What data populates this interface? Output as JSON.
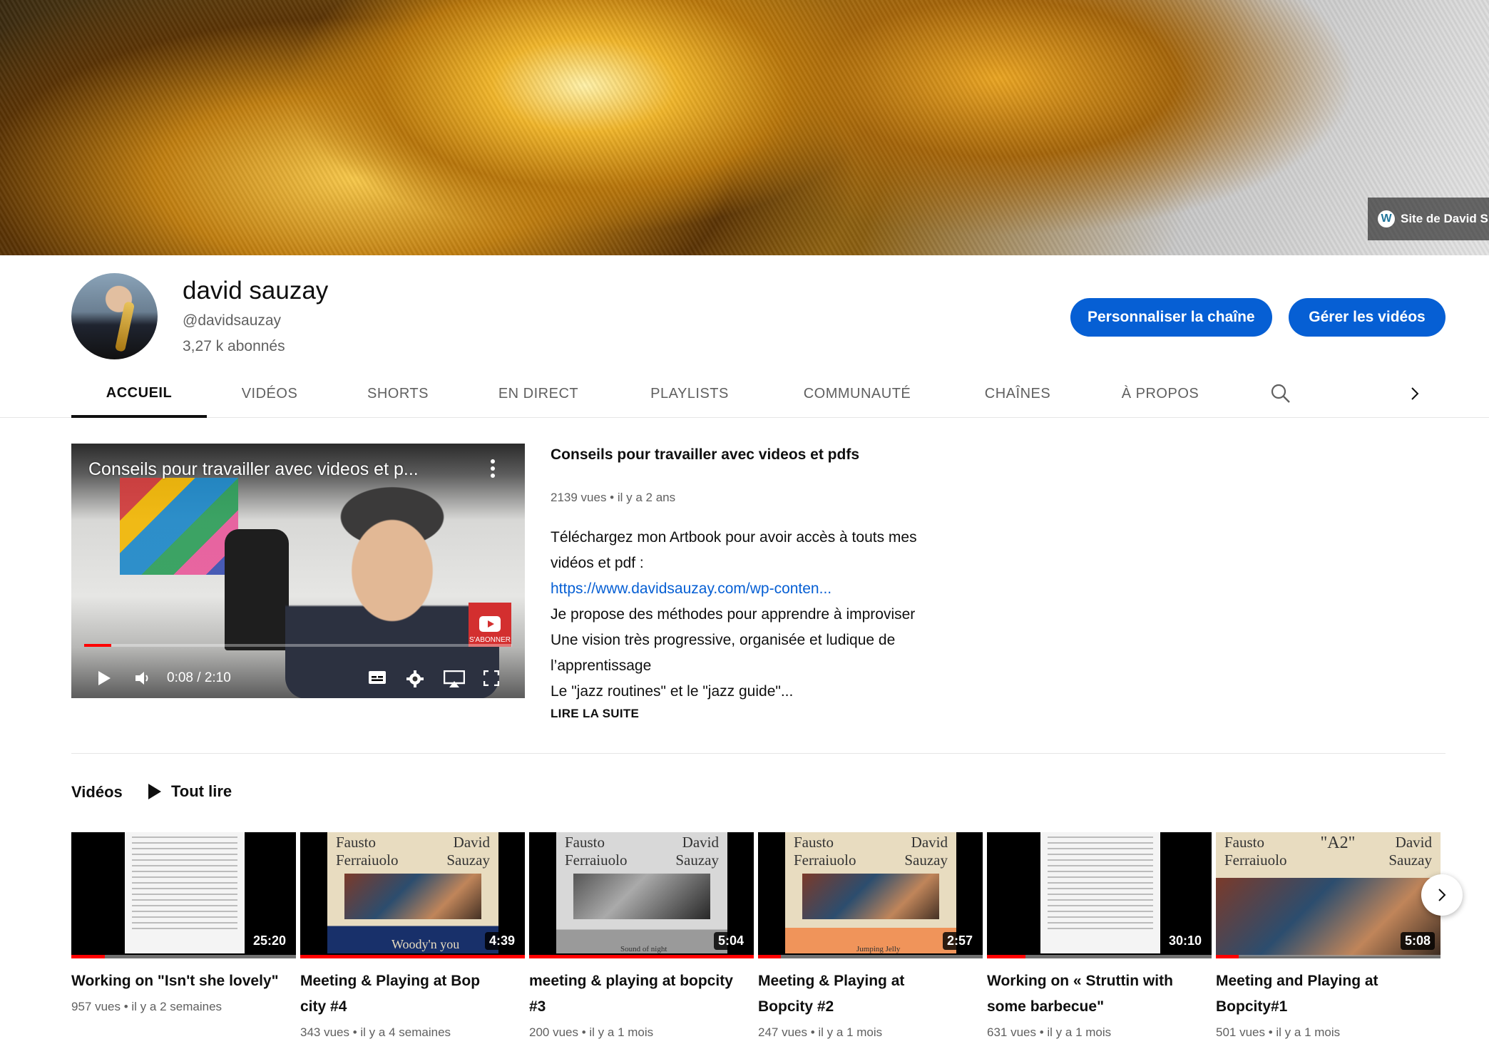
{
  "banner": {
    "link_label": "Site de David S"
  },
  "channel": {
    "name": "david sauzay",
    "handle": "@davidsauzay",
    "subscribers": "3,27 k abonnés",
    "customize_label": "Personnaliser la chaîne",
    "manage_label": "Gérer les vidéos"
  },
  "tabs": [
    "ACCUEIL",
    "VIDÉOS",
    "SHORTS",
    "EN DIRECT",
    "PLAYLISTS",
    "COMMUNAUTÉ",
    "CHAÎNES",
    "À PROPOS"
  ],
  "featured": {
    "overlay_title": "Conseils pour travailler avec videos et p...",
    "subscribe_badge": "S'ABONNER",
    "time": "0:08 / 2:10",
    "progress_fraction": 0.064,
    "title": "Conseils pour travailler avec videos et pdfs",
    "views": "2139 vues",
    "age": "il y a 2 ans",
    "desc_lines": [
      "Téléchargez mon Artbook pour avoir accès à touts mes",
      "vidéos et pdf :",
      "https://www.davidsauzay.com/wp-conten...",
      "Je propose des méthodes pour apprendre à improviser",
      "Une vision très progressive, organisée et ludique de",
      "l’apprentissage",
      "Le \"jazz routines\" et le \"jazz guide\"..."
    ],
    "read_more": "LIRE LA SUITE"
  },
  "shelf": {
    "title": "Vidéos",
    "play_all": "Tout lire",
    "videos": [
      {
        "title_l1": "Working on \"Isn't she lovely\"",
        "title_l2": "",
        "duration": "25:20",
        "views": "957 vues",
        "age": "il y a 2 semaines",
        "watched": 0.15
      },
      {
        "title_l1": "Meeting & Playing at Bop",
        "title_l2": "city #4",
        "duration": "4:39",
        "views": "343 vues",
        "age": "il y a 4 semaines",
        "watched": 1.0,
        "poster_left": "Fausto",
        "poster_left2": "Ferraiuolo",
        "poster_right": "David",
        "poster_right2": "Sauzay",
        "caption": "Woody'n you"
      },
      {
        "title_l1": "meeting & playing at bopcity",
        "title_l2": "#3",
        "duration": "5:04",
        "views": "200 vues",
        "age": "il y a 1 mois",
        "watched": 1.0,
        "poster_left": "Fausto",
        "poster_left2": "Ferraiuolo",
        "poster_right": "David",
        "poster_right2": "Sauzay",
        "caption": "Sound of night"
      },
      {
        "title_l1": "Meeting & Playing at",
        "title_l2": "Bopcity #2",
        "duration": "2:57",
        "views": "247 vues",
        "age": "il y a 1 mois",
        "watched": 0.1,
        "poster_left": "Fausto",
        "poster_left2": "Ferraiuolo",
        "poster_right": "David",
        "poster_right2": "Sauzay",
        "caption": "Jumping Jelly"
      },
      {
        "title_l1": "Working on « Struttin with",
        "title_l2": "some barbecue\"",
        "duration": "30:10",
        "views": "631 vues",
        "age": "il y a 1 mois",
        "watched": 0.17
      },
      {
        "title_l1": "Meeting and Playing at",
        "title_l2": "Bopcity#1",
        "duration": "5:08",
        "views": "501 vues",
        "age": "il y a 1 mois",
        "watched": 0.1,
        "poster_left": "Fausto",
        "poster_left2": "Ferraiuolo",
        "poster_right": "David",
        "poster_right2": "Sauzay",
        "caption": "\"A2\""
      }
    ]
  },
  "colors": {
    "accent": "#065fd4",
    "progress": "#ff0000",
    "text": "#0f0f0f",
    "secondary": "#606060"
  }
}
